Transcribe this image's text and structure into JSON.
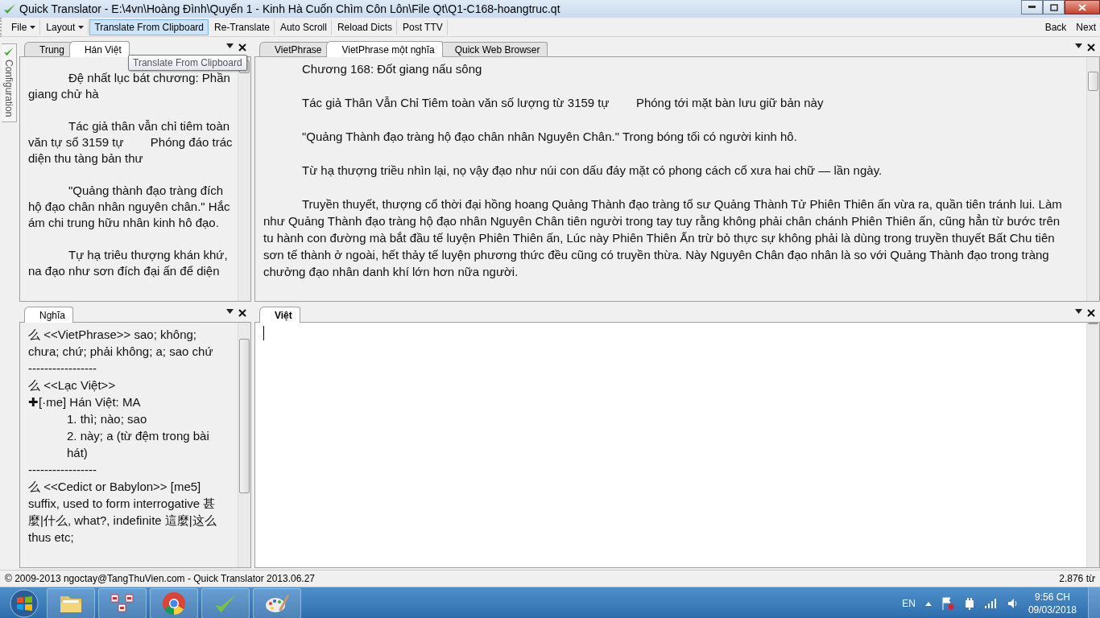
{
  "window": {
    "title": "Quick Translator - E:\\4vn\\Hoàng Đình\\Quyển 1 - Kinh Hà Cuốn Chìm Côn Lôn\\File Qt\\Q1-C168-hoangtruc.qt"
  },
  "toolbar": {
    "items": [
      {
        "label": "File",
        "dropdown": true,
        "selected": false
      },
      {
        "label": "Layout",
        "dropdown": true,
        "selected": false
      },
      {
        "label": "Translate From Clipboard",
        "dropdown": false,
        "selected": true
      },
      {
        "label": "Re-Translate",
        "dropdown": false,
        "selected": false
      },
      {
        "label": "Auto Scroll",
        "dropdown": false,
        "selected": false
      },
      {
        "label": "Reload Dicts",
        "dropdown": false,
        "selected": false
      },
      {
        "label": "Post TTV",
        "dropdown": false,
        "selected": false
      }
    ],
    "nav": [
      "Back",
      "Next"
    ]
  },
  "side_tab": {
    "label": "Configuration"
  },
  "tooltip": "Translate From Clipboard",
  "han_viet_pane": {
    "tabs": [
      {
        "label": "Trung",
        "selected": false
      },
      {
        "label": "Hán Việt",
        "selected": true
      }
    ],
    "paragraphs": [
      "Đệ nhất lục bát chương: Phần giang chử hà",
      "Tác giả thân vẫn chỉ tiêm toàn văn tự sổ 3159 tự        Phóng đáo trác diện thu tàng bản thư",
      "\"Quảng thành đạo tràng đích hộ đạo chân nhân nguyên chân.\" Hắc ám chi trung hữu nhân kinh hô đạo.",
      "Tự hạ triêu thượng khán khứ, na đạo như sơn đích đại ấn để diện"
    ]
  },
  "meaning_pane": {
    "tabs": [
      {
        "label": "Nghĩa",
        "selected": true
      }
    ],
    "lines": [
      {
        "kind": "text",
        "text": "么 <<VietPhrase>> sao; không; chưa; chứ;  phải không; a; sao chứ"
      },
      {
        "kind": "text",
        "text": "-----------------"
      },
      {
        "kind": "text",
        "text": "么 <<Lạc Việt>>"
      },
      {
        "kind": "text",
        "text": "✚[·me] Hán Việt: MA"
      },
      {
        "kind": "indented",
        "text": "1. thì; nào; sao"
      },
      {
        "kind": "indented",
        "text": "2. này; a (từ đệm trong bài hát)"
      },
      {
        "kind": "text",
        "text": "-----------------"
      },
      {
        "kind": "text",
        "text": "么 <<Cedict or Babylon>>  [me5] suffix, used to form interrogative 甚麼|什么, what?, indefinite 這麼|这么 thus etc;"
      }
    ]
  },
  "translation_pane": {
    "tabs": [
      {
        "label": "VietPhrase",
        "selected": false
      },
      {
        "label": "VietPhrase một nghĩa",
        "selected": true
      },
      {
        "label": "Quick Web Browser",
        "selected": false
      }
    ],
    "paragraphs": [
      "Chương 168: Đốt giang nấu sông",
      "Tác giả Thân Vẫn Chỉ Tiêm toàn văn số lượng từ 3159 tự        Phóng tới mặt bàn lưu giữ bản này",
      "\"Quảng Thành đạo tràng hộ đạo chân nhân Nguyên Chân.\" Trong bóng tối có người kinh hô.",
      "Từ hạ thượng triều nhìn lại, nọ vậy đạo như núi con dấu đáy mặt có phong cách cổ xưa hai chữ — lần ngày.",
      "Truyền thuyết, thượng cổ thời đại hồng hoang Quảng Thành đạo tràng tổ sư Quảng Thành Tử Phiên Thiên ấn vừa ra, quần tiên tránh lui. Làm như Quảng Thành đạo tràng hộ đạo nhân Nguyên Chân tiên người trong tay tuy rằng không phải chân chánh Phiên Thiên ấn, cũng hẳn từ bước trên tu hành con đường mà bắt đầu tế luyện Phiên Thiên ấn, Lúc này Phiên Thiên Ấn trừ bỏ thực sự không phải là dùng trong truyền thuyết Bất Chu tiên sơn tế thành ở ngoài, hết thảy tế luyện phương thức đều cũng có truyền thừa. Này Nguyên Chân đạo nhân là so với Quảng Thành đạo trong tràng chưởng đạo nhân danh khí lớn hơn nữa người."
    ]
  },
  "viet_pane": {
    "tabs": [
      {
        "label": "Việt",
        "selected": true
      }
    ]
  },
  "status_bar": {
    "left": "© 2009-2013 ngoctay@TangThuVien.com - Quick Translator 2013.06.27",
    "right": "2.876 từ"
  },
  "taskbar": {
    "language": "EN",
    "time": "9:56 CH",
    "date": "09/03/2018"
  }
}
